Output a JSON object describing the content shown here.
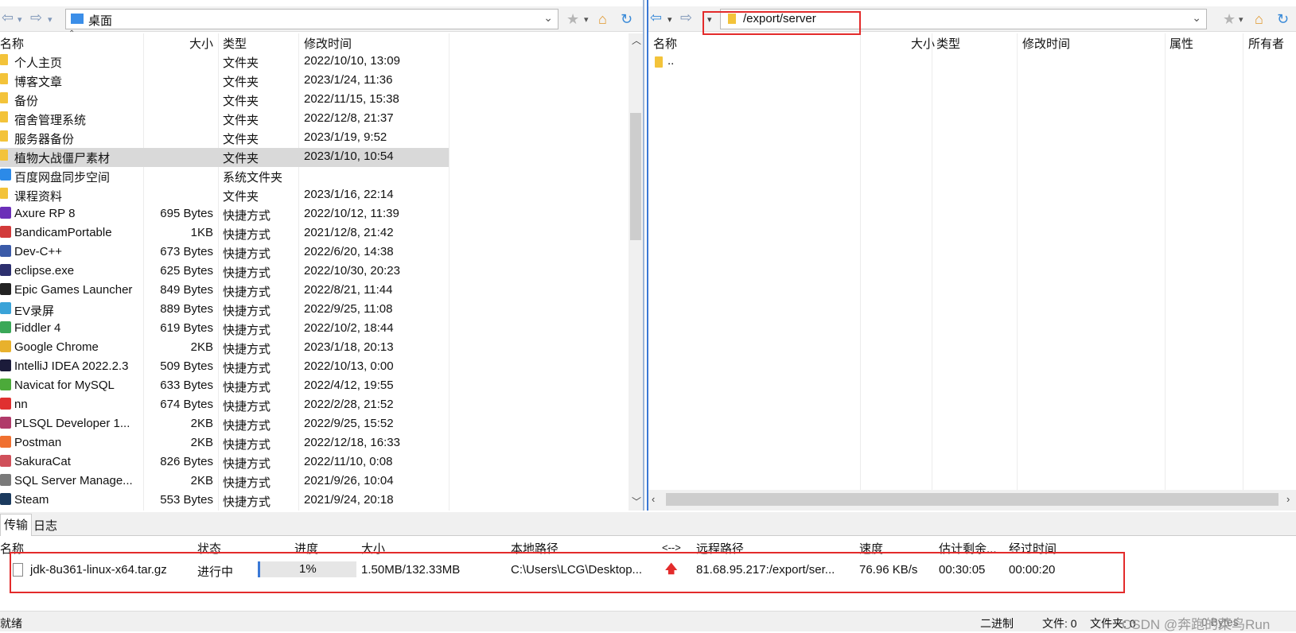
{
  "left": {
    "path": "桌面",
    "columns": [
      "名称",
      "大小",
      "类型",
      "修改时间"
    ],
    "rows": [
      {
        "name": "个人主页",
        "size": "",
        "type": "文件夹",
        "mtime": "2022/10/10, 13:09",
        "icon": "folder-icon",
        "color": "#f3c33a"
      },
      {
        "name": "博客文章",
        "size": "",
        "type": "文件夹",
        "mtime": "2023/1/24, 11:36",
        "icon": "folder-icon",
        "color": "#f3c33a"
      },
      {
        "name": "备份",
        "size": "",
        "type": "文件夹",
        "mtime": "2022/11/15, 15:38",
        "icon": "folder-icon",
        "color": "#f3c33a"
      },
      {
        "name": "宿舍管理系统",
        "size": "",
        "type": "文件夹",
        "mtime": "2022/12/8, 21:37",
        "icon": "folder-icon",
        "color": "#f3c33a"
      },
      {
        "name": "服务器备份",
        "size": "",
        "type": "文件夹",
        "mtime": "2023/1/19, 9:52",
        "icon": "folder-icon",
        "color": "#f3c33a"
      },
      {
        "name": "植物大战僵尸素材",
        "size": "",
        "type": "文件夹",
        "mtime": "2023/1/10, 10:54",
        "icon": "folder-icon",
        "color": "#f3c33a",
        "selected": true
      },
      {
        "name": "百度网盘同步空间",
        "size": "",
        "type": "系统文件夹",
        "mtime": "",
        "icon": "baidu-cloud-icon",
        "color": "#2c8ae8"
      },
      {
        "name": "课程资料",
        "size": "",
        "type": "文件夹",
        "mtime": "2023/1/16, 22:14",
        "icon": "folder-icon",
        "color": "#f3c33a"
      },
      {
        "name": "Axure RP 8",
        "size": "695 Bytes",
        "type": "快捷方式",
        "mtime": "2022/10/12, 11:39",
        "icon": "axure-icon",
        "color": "#6b2fb8"
      },
      {
        "name": "BandicamPortable",
        "size": "1KB",
        "type": "快捷方式",
        "mtime": "2021/12/8, 21:42",
        "icon": "bandicam-icon",
        "color": "#d23a3a"
      },
      {
        "name": "Dev-C++",
        "size": "673 Bytes",
        "type": "快捷方式",
        "mtime": "2022/6/20, 14:38",
        "icon": "devcpp-icon",
        "color": "#3a5aa8"
      },
      {
        "name": "eclipse.exe",
        "size": "625 Bytes",
        "type": "快捷方式",
        "mtime": "2022/10/30, 20:23",
        "icon": "eclipse-icon",
        "color": "#2c2f6e"
      },
      {
        "name": "Epic Games Launcher",
        "size": "849 Bytes",
        "type": "快捷方式",
        "mtime": "2022/8/21, 11:44",
        "icon": "epic-games-icon",
        "color": "#222222"
      },
      {
        "name": "EV录屏",
        "size": "889 Bytes",
        "type": "快捷方式",
        "mtime": "2022/9/25, 11:08",
        "icon": "ev-recorder-icon",
        "color": "#3aa3d8"
      },
      {
        "name": "Fiddler 4",
        "size": "619 Bytes",
        "type": "快捷方式",
        "mtime": "2022/10/2, 18:44",
        "icon": "fiddler-icon",
        "color": "#3aa858"
      },
      {
        "name": "Google Chrome",
        "size": "2KB",
        "type": "快捷方式",
        "mtime": "2023/1/18, 20:13",
        "icon": "chrome-icon",
        "color": "#e8b12c"
      },
      {
        "name": "IntelliJ IDEA 2022.2.3",
        "size": "509 Bytes",
        "type": "快捷方式",
        "mtime": "2022/10/13, 0:00",
        "icon": "intellij-icon",
        "color": "#1b1b3a"
      },
      {
        "name": "Navicat for MySQL",
        "size": "633 Bytes",
        "type": "快捷方式",
        "mtime": "2022/4/12, 19:55",
        "icon": "navicat-icon",
        "color": "#4caa3a"
      },
      {
        "name": "nn",
        "size": "674 Bytes",
        "type": "快捷方式",
        "mtime": "2022/2/28, 21:52",
        "icon": "nn-icon",
        "color": "#e03030"
      },
      {
        "name": "PLSQL Developer 1...",
        "size": "2KB",
        "type": "快捷方式",
        "mtime": "2022/9/25, 15:52",
        "icon": "plsql-icon",
        "color": "#b03a6a"
      },
      {
        "name": "Postman",
        "size": "2KB",
        "type": "快捷方式",
        "mtime": "2022/12/18, 16:33",
        "icon": "postman-icon",
        "color": "#f07030"
      },
      {
        "name": "SakuraCat",
        "size": "826 Bytes",
        "type": "快捷方式",
        "mtime": "2022/11/10, 0:08",
        "icon": "sakuracat-icon",
        "color": "#d0505a"
      },
      {
        "name": "SQL Server Manage...",
        "size": "2KB",
        "type": "快捷方式",
        "mtime": "2021/9/26, 10:04",
        "icon": "sql-server-icon",
        "color": "#7a7a7a"
      },
      {
        "name": "Steam",
        "size": "553 Bytes",
        "type": "快捷方式",
        "mtime": "2021/9/24, 20:18",
        "icon": "steam-icon",
        "color": "#1b3a5e"
      }
    ]
  },
  "right": {
    "path": "/export/server",
    "columns": [
      "名称",
      "大小",
      "类型",
      "修改时间",
      "属性",
      "所有者"
    ],
    "rows": [
      {
        "name": "..",
        "icon": "folder-icon"
      }
    ]
  },
  "bottom": {
    "tabs": [
      "传输",
      "日志"
    ],
    "columns": [
      "名称",
      "状态",
      "进度",
      "大小",
      "本地路径",
      "<-->",
      "远程路径",
      "速度",
      "估计剩余...",
      "经过时间"
    ],
    "transfer": {
      "name": "jdk-8u361-linux-x64.tar.gz",
      "status": "进行中",
      "progress_label": "1%",
      "progress": 0.01,
      "size": "1.50MB/132.33MB",
      "local": "C:\\Users\\LCG\\Desktop...",
      "direction": "upload-arrow-icon",
      "remote": "81.68.95.217:/export/ser...",
      "speed": "76.96 KB/s",
      "remaining": "00:30:05",
      "elapsed": "00:00:20"
    }
  },
  "status": {
    "ready": "就绪",
    "mode": "二进制",
    "files": "文件: 0",
    "folders": "文件夹: 0",
    "bytes": "0 Bytes",
    "watermark": "CSDN @奔跑的菜鸟Run"
  }
}
